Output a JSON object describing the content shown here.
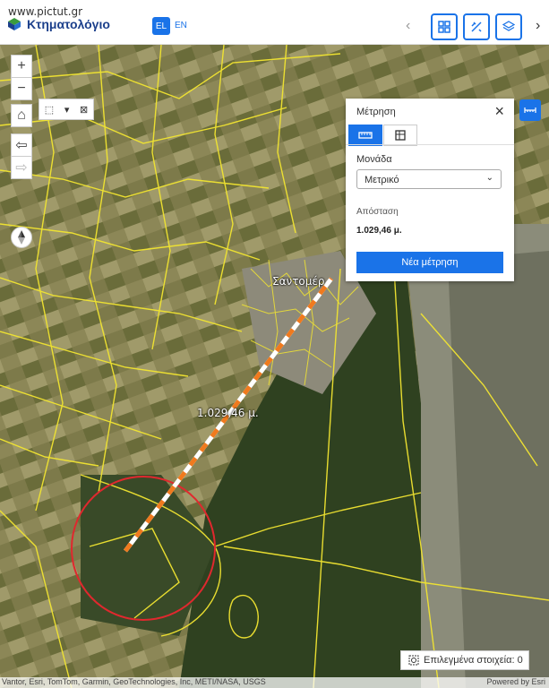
{
  "watermark": "www.pictut.gr",
  "brand": {
    "name": "Κτηματολόγιο"
  },
  "lang": {
    "active": "EL",
    "other": "EN"
  },
  "toolbar": {
    "prev_icon": "chevron-left-icon",
    "next_icon": "chevron-right-icon",
    "tools": [
      "grid-icon",
      "tools-icon",
      "layers-icon"
    ]
  },
  "measure_panel": {
    "title": "Μέτρηση",
    "tabs": [
      "distance-icon",
      "area-icon"
    ],
    "unit_label": "Μονάδα",
    "unit_value": "Μετρικό",
    "distance_label": "Απόσταση",
    "distance_value": "1.029,46 μ.",
    "new_button": "Νέα μέτρηση"
  },
  "map": {
    "place_label": "Σαντομέρ",
    "measure_label": "1.029,46 μ.",
    "colors": {
      "parcel": "#f2e531",
      "measure_a": "#ffffff",
      "measure_b": "#f07a1e",
      "circle": "#e0282e",
      "accent": "#1a73e8"
    }
  },
  "selected": {
    "text": "Επιλεγμένα στοιχεία: 0"
  },
  "attribution": {
    "text": "Vantor, Esri, TomTom, Garmin, GeoTechnologies, Inc, METI/NASA, USGS",
    "powered": "Powered by Esri"
  }
}
